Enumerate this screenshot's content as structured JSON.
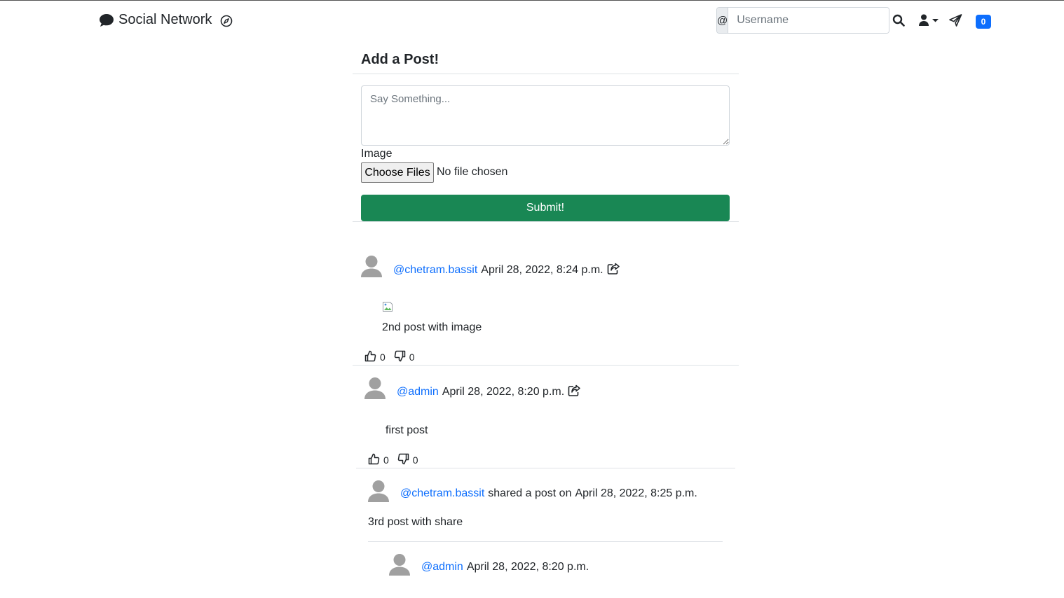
{
  "navbar": {
    "brand": "Social Network",
    "search_prefix": "@",
    "search_placeholder": "Username",
    "notification_count": "0"
  },
  "composer": {
    "title": "Add a Post!",
    "textarea_placeholder": "Say Something...",
    "image_label": "Image",
    "file_button": "Choose Files",
    "file_status": "No file chosen",
    "submit": "Submit!"
  },
  "posts": [
    {
      "username": "@chetram.bassit",
      "timestamp": "April 28, 2022, 8:24 p.m.",
      "text": "2nd post with image",
      "likes": "0",
      "dislikes": "0"
    },
    {
      "username": "@admin",
      "timestamp": "April 28, 2022, 8:20 p.m.",
      "text": "first post",
      "likes": "0",
      "dislikes": "0"
    },
    {
      "username": "@chetram.bassit",
      "shared_prefix": "shared a post on",
      "timestamp": "April 28, 2022, 8:25 p.m.",
      "text": "3rd post with share",
      "original": {
        "username": "@admin",
        "timestamp": "April 28, 2022, 8:20 p.m."
      }
    }
  ]
}
